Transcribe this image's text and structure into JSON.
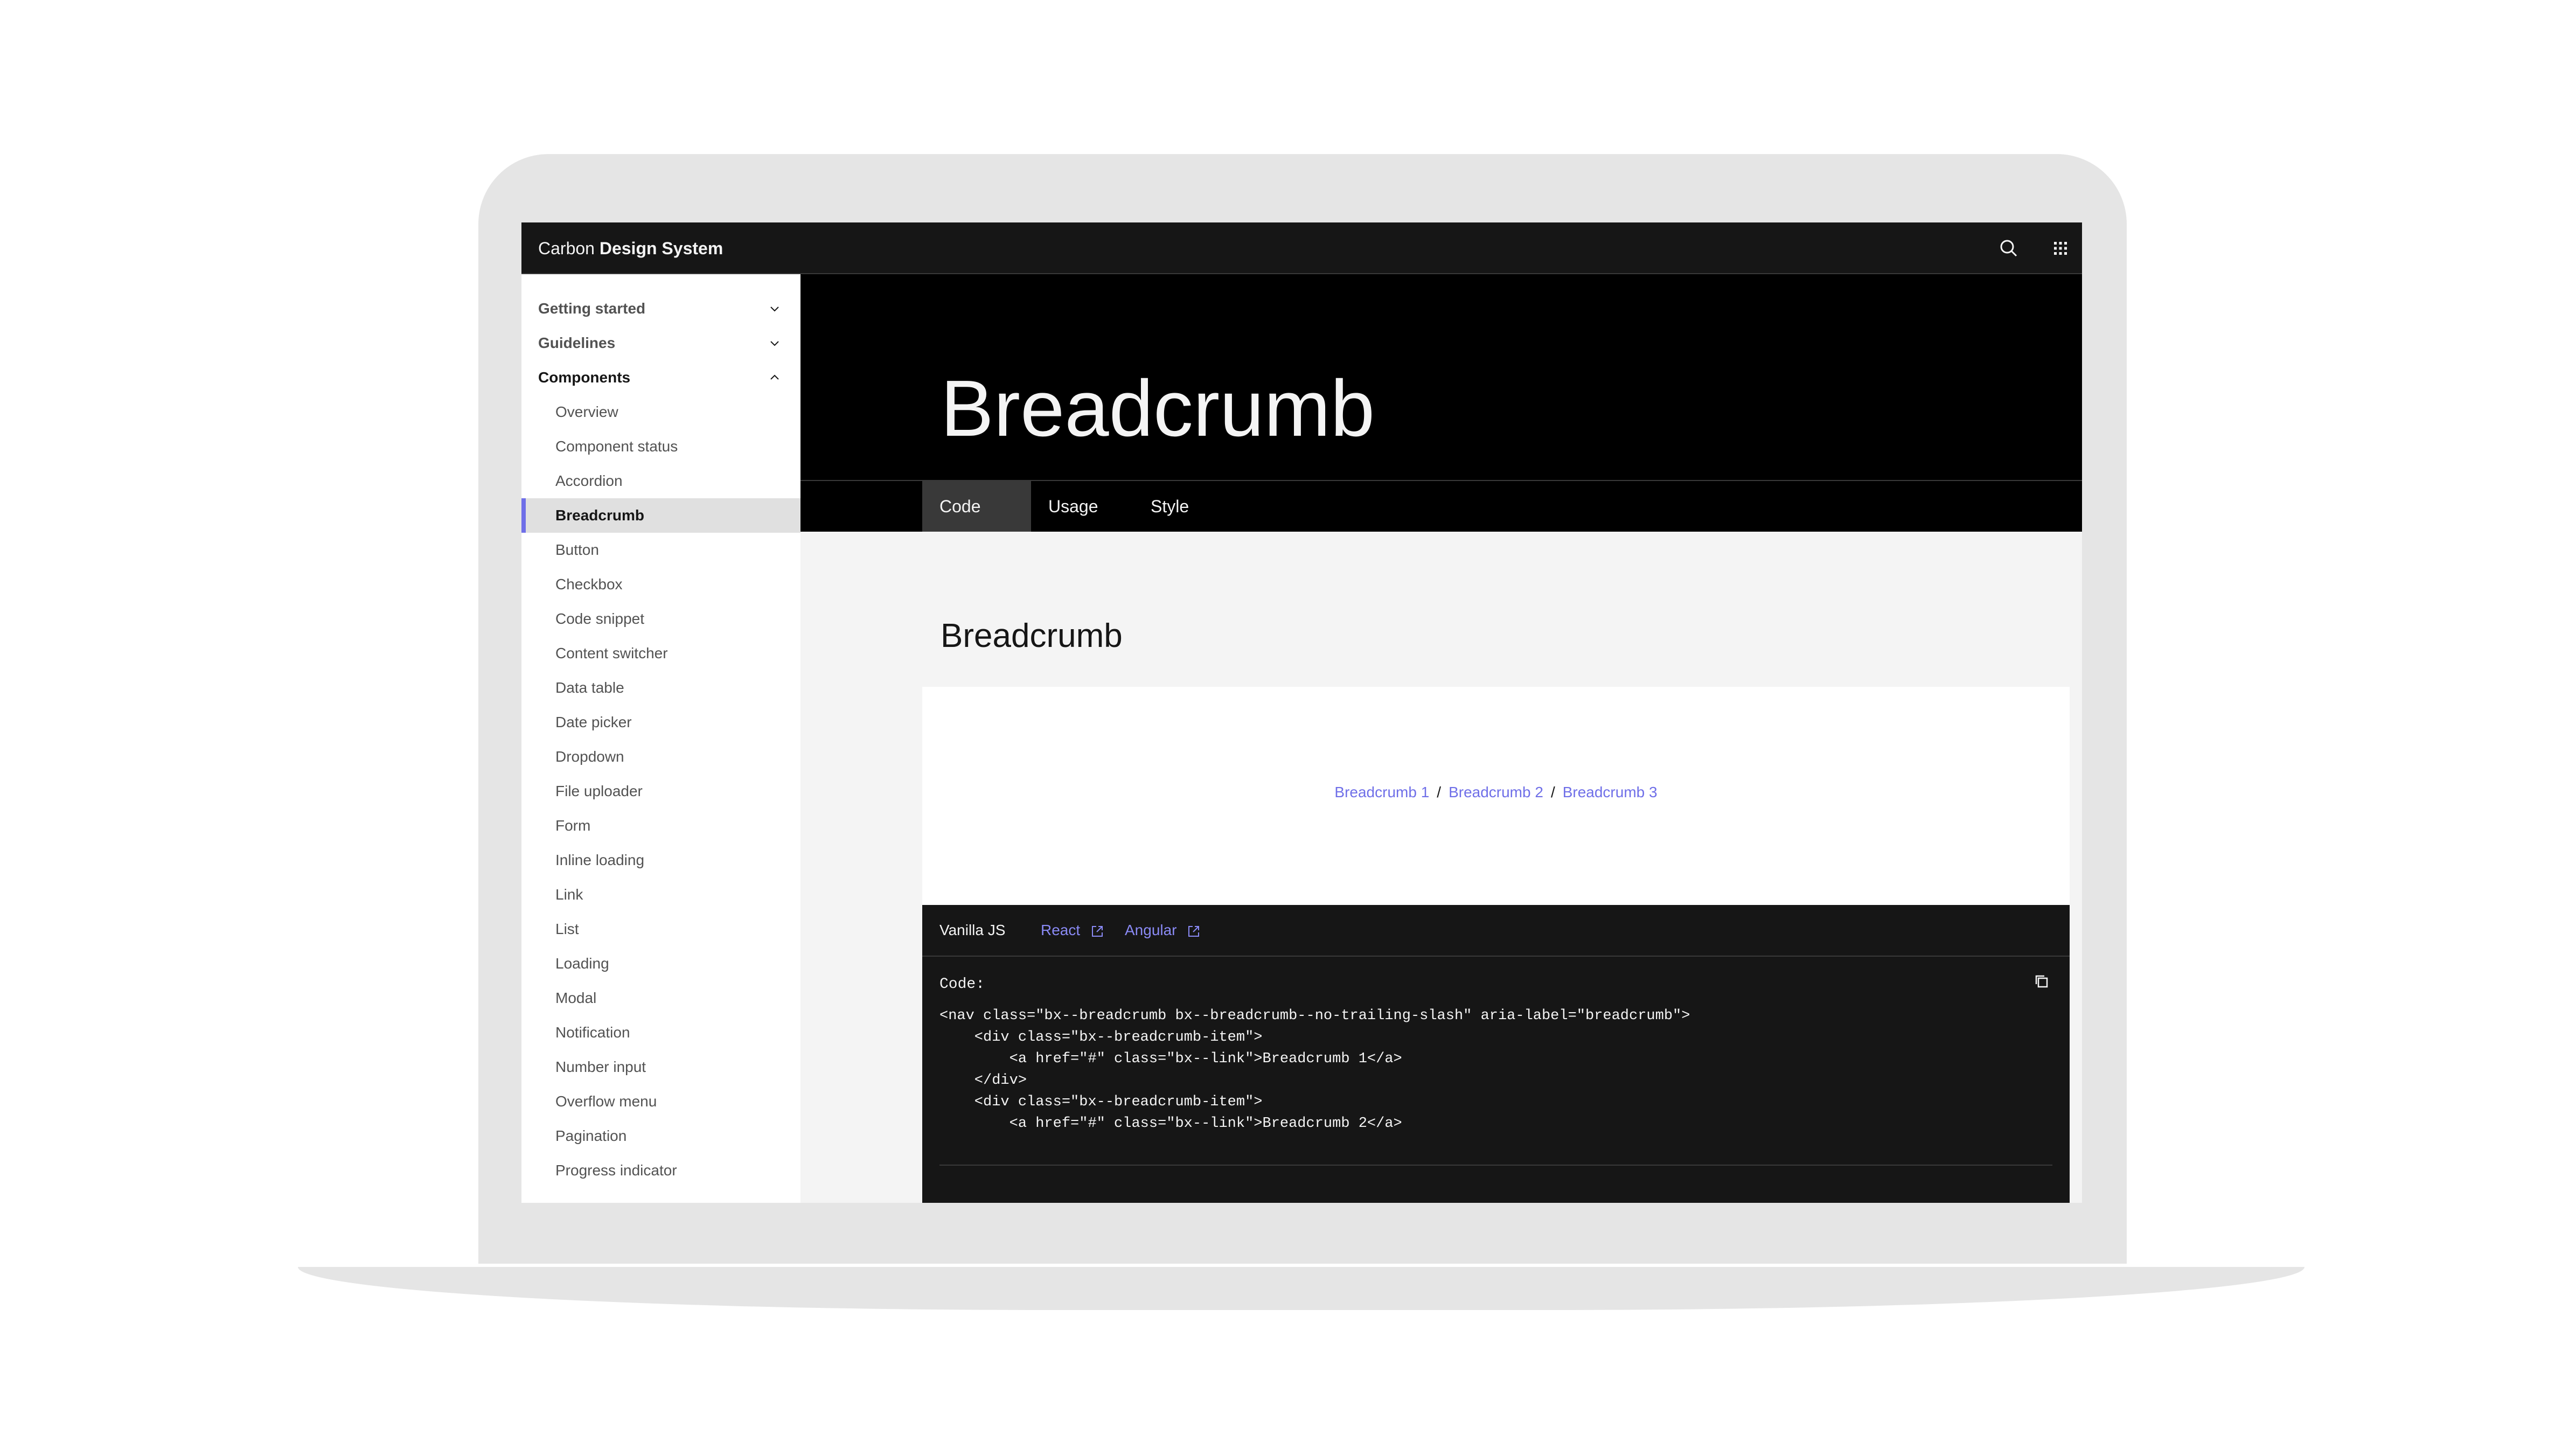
{
  "header": {
    "brand_light": "Carbon",
    "brand_bold": "Design System",
    "search_icon": "search-icon",
    "apps_icon": "app-switcher-icon"
  },
  "sidebar": {
    "categories": [
      {
        "label": "Getting started",
        "expanded": false
      },
      {
        "label": "Guidelines",
        "expanded": false
      },
      {
        "label": "Components",
        "expanded": true
      }
    ],
    "items": [
      {
        "label": "Overview"
      },
      {
        "label": "Component status"
      },
      {
        "label": "Accordion"
      },
      {
        "label": "Breadcrumb",
        "active": true
      },
      {
        "label": "Button"
      },
      {
        "label": "Checkbox"
      },
      {
        "label": "Code snippet"
      },
      {
        "label": "Content switcher"
      },
      {
        "label": "Data table"
      },
      {
        "label": "Date picker"
      },
      {
        "label": "Dropdown"
      },
      {
        "label": "File uploader"
      },
      {
        "label": "Form"
      },
      {
        "label": "Inline loading"
      },
      {
        "label": "Link"
      },
      {
        "label": "List"
      },
      {
        "label": "Loading"
      },
      {
        "label": "Modal"
      },
      {
        "label": "Notification"
      },
      {
        "label": "Number input"
      },
      {
        "label": "Overflow menu"
      },
      {
        "label": "Pagination"
      },
      {
        "label": "Progress indicator"
      }
    ]
  },
  "hero": {
    "title": "Breadcrumb"
  },
  "tabs": [
    {
      "label": "Code",
      "active": true
    },
    {
      "label": "Usage"
    },
    {
      "label": "Style"
    }
  ],
  "section": {
    "title": "Breadcrumb"
  },
  "demo": {
    "crumbs": [
      "Breadcrumb 1",
      "Breadcrumb 2",
      "Breadcrumb 3"
    ],
    "separator": "/"
  },
  "code_panel": {
    "tab_vanilla": "Vanilla JS",
    "tab_react": "React",
    "tab_angular": "Angular",
    "external_icon": "launch-icon",
    "copy_icon": "copy-icon",
    "label": "Code:",
    "lines": [
      "<nav class=\"bx--breadcrumb bx--breadcrumb--no-trailing-slash\" aria-label=\"breadcrumb\">",
      "    <div class=\"bx--breadcrumb-item\">",
      "        <a href=\"#\" class=\"bx--link\">Breadcrumb 1</a>",
      "    </div>",
      "    <div class=\"bx--breadcrumb-item\">",
      "        <a href=\"#\" class=\"bx--link\">Breadcrumb 2</a>"
    ]
  },
  "colors": {
    "accent": "#6f6fe8",
    "header_bg": "#161616",
    "hero_bg": "#000000",
    "content_bg": "#f4f4f4",
    "laptop_frame": "#e5e5e5"
  }
}
